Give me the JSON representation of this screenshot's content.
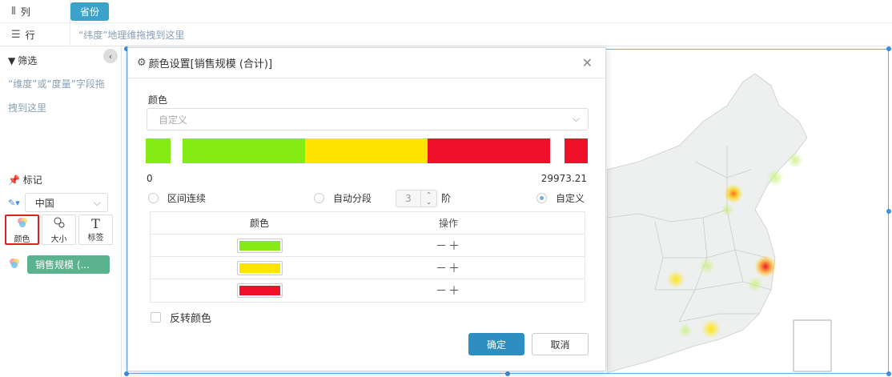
{
  "shelves": {
    "columns": {
      "label": "列",
      "icon": "columns-icon",
      "pill": "省份"
    },
    "rows": {
      "label": "行",
      "icon": "rows-icon",
      "hint": "“纬度”地理维拖拽到这里"
    }
  },
  "filter": {
    "title": "筛选",
    "hint": "“维度”或“度量”字段拖拽到这里"
  },
  "marks": {
    "title": "标记",
    "map_type": "中国",
    "buttons": [
      {
        "label": "颜色",
        "icon": "color-palette-icon"
      },
      {
        "label": "大小",
        "icon": "size-circles-icon"
      },
      {
        "label": "标签",
        "icon": "text-label-icon"
      }
    ],
    "field_pill": "销售规模 (..."
  },
  "dialog": {
    "title": "颜色设置[销售规模 (合计)]",
    "color_section_label": "颜色",
    "color_select_placeholder": "自定义",
    "range_min": "0",
    "range_max": "29973.21",
    "modes": [
      {
        "label": "区间连续",
        "selected": false
      },
      {
        "label": "自动分段",
        "selected": false
      },
      {
        "label": "自定义",
        "selected": true
      }
    ],
    "segments_value": "3",
    "segments_suffix": "阶",
    "table": {
      "headers": [
        "颜色",
        "操作"
      ],
      "rows": [
        {
          "color": "#84ec14",
          "ops": "－＋"
        },
        {
          "color": "#ffe400",
          "ops": "－＋"
        },
        {
          "color": "#f1102a",
          "ops": "－＋"
        }
      ]
    },
    "reverse_label": "反转颜色",
    "ok_label": "确定",
    "cancel_label": "取消"
  },
  "colors": {
    "green": "#84ec14",
    "yellow": "#ffe400",
    "red": "#f1102a",
    "accent": "#2f8ec1"
  }
}
